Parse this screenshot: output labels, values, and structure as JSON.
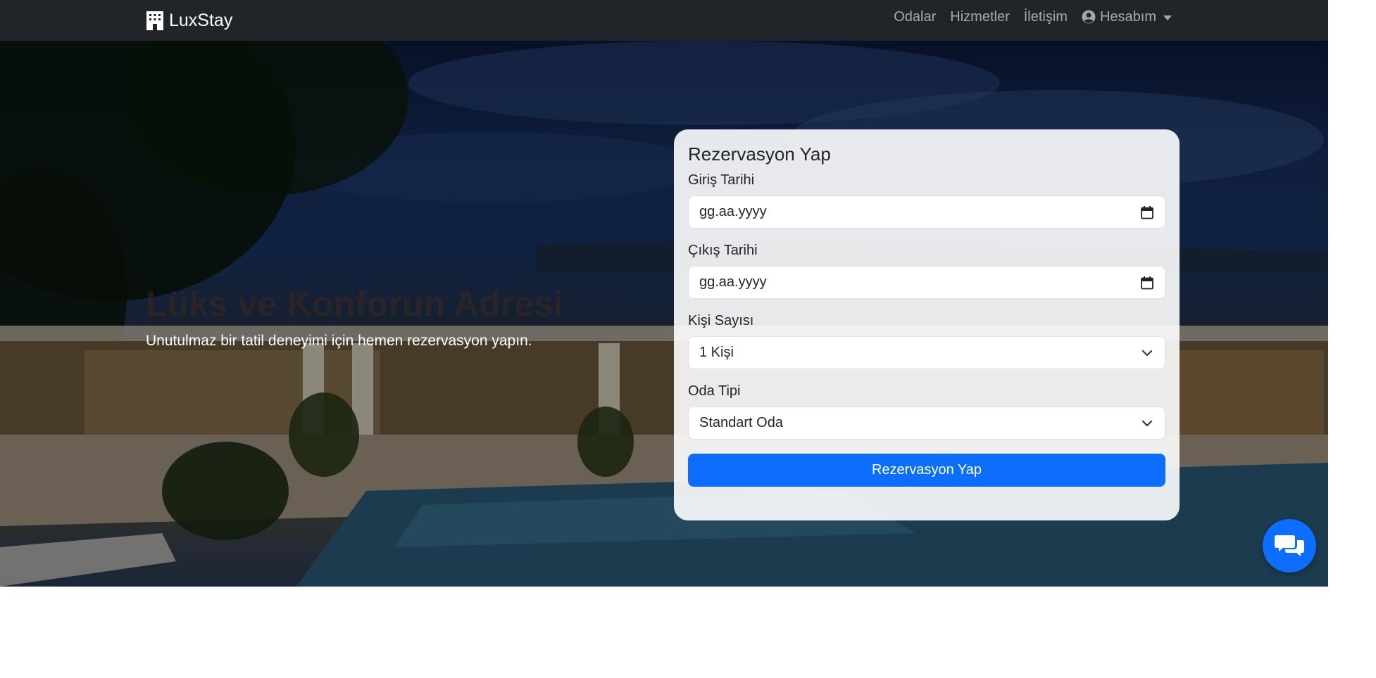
{
  "navbar": {
    "brand": "LuxStay",
    "links": [
      "Odalar",
      "Hizmetler",
      "İletişim"
    ],
    "account_label": "Hesabım"
  },
  "hero": {
    "title": "Lüks ve Konforun Adresi",
    "subtitle": "Unutulmaz bir tatil deneyimi için hemen rezervasyon yapın."
  },
  "reservation": {
    "heading": "Rezervasyon Yap",
    "checkin_label": "Giriş Tarihi",
    "checkin_placeholder": "gg.aa.yyyy",
    "checkout_label": "Çıkış Tarihi",
    "checkout_placeholder": "gg.aa.yyyy",
    "guests_label": "Kişi Sayısı",
    "guests_value": "1 Kişi",
    "room_label": "Oda Tipi",
    "room_value": "Standart Oda",
    "submit_label": "Rezervasyon Yap"
  },
  "colors": {
    "navbar_bg": "#212529",
    "primary": "#0d6efd"
  },
  "icons": [
    "hotel-icon",
    "user-circle-icon",
    "calendar-icon",
    "chevron-down-icon",
    "chat-icon"
  ]
}
